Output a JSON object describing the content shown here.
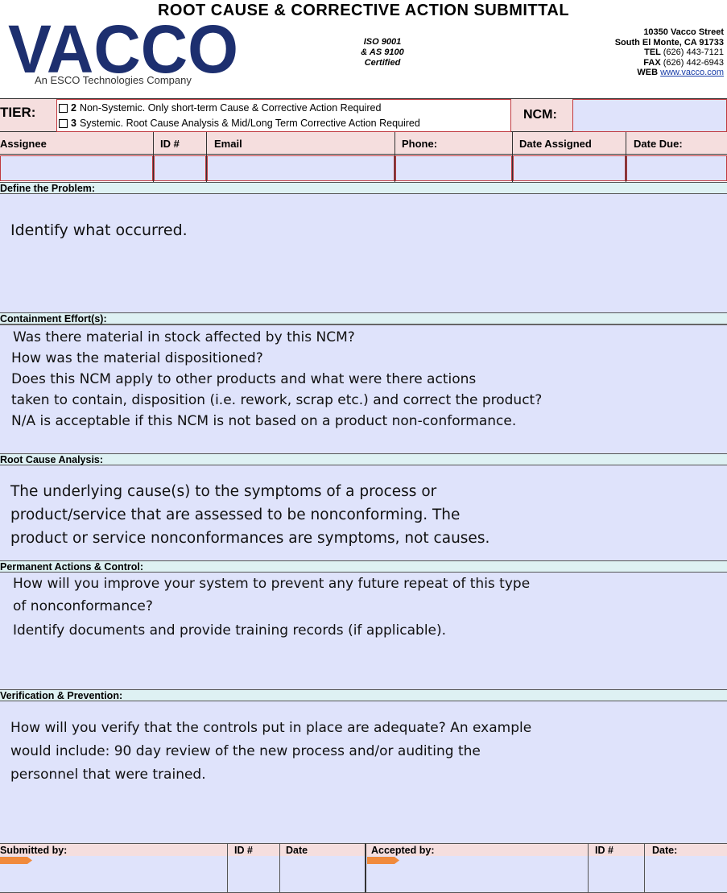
{
  "header": {
    "title": "ROOT CAUSE & CORRECTIVE ACTION SUBMITTAL",
    "logo_text": "VACCO",
    "tagline": "An ESCO Technologies Company",
    "certification": [
      "ISO 9001",
      "& AS 9100",
      "Certified"
    ],
    "address": {
      "street": "10350 Vacco Street",
      "city": "South El Monte, CA 91733",
      "tel_label": "TEL",
      "tel": "(626) 443-7121",
      "fax_label": "FAX",
      "fax": "(626) 442-6943",
      "web_label": "WEB",
      "web": "www.vacco.com"
    }
  },
  "tier": {
    "label": "TIER:",
    "option2_num": "2",
    "option2": "Non-Systemic.  Only short-term Cause & Corrective Action Required",
    "option3_num": "3",
    "option3": "Systemic.  Root Cause Analysis & Mid/Long Term Corrective Action Required",
    "ncm_label": "NCM:"
  },
  "assignment_headers": {
    "assignee": "Assignee",
    "id": "ID #",
    "email": "Email",
    "phone": "Phone:",
    "date_assigned": "Date Assigned",
    "date_due": "Date Due:"
  },
  "sections": {
    "problem": {
      "title": "Define the Problem:",
      "lines": [
        "Identify what occurred."
      ]
    },
    "containment": {
      "title": "Containment Effort(s):",
      "lines": [
        "Was there material in stock affected by this NCM?",
        "How was the material dispositioned?",
        "Does this NCM apply to other products and what were there actions",
        "taken to contain, disposition (i.e. rework, scrap etc.) and correct the product?",
        "N/A is acceptable if this NCM is not based on a product non-conformance."
      ]
    },
    "root_cause": {
      "title": "Root Cause Analysis:",
      "lines": [
        "The underlying cause(s) to the symptoms of a process or",
        "product/service that are assessed to be nonconforming.  The",
        "product or service nonconformances are symptoms, not causes."
      ]
    },
    "permanent": {
      "title": "Permanent Actions & Control:",
      "lines": [
        "How will you improve your system to prevent any future repeat of this type",
        "of nonconformance?",
        "Identify documents and provide training records (if applicable)."
      ]
    },
    "verification": {
      "title": "Verification & Prevention:",
      "lines": [
        "How will you verify that the controls put in place are adequate? An example",
        "would include: 90 day review of the new process and/or auditing the",
        "personnel that were trained."
      ]
    }
  },
  "footer": {
    "submitted_by": "Submitted by:",
    "submitted_id": "ID #",
    "submitted_date": "Date",
    "accepted_by": "Accepted by:",
    "accepted_id": "ID #",
    "accepted_date": "Date:"
  },
  "colors": {
    "accent_red": "#c0393f",
    "brand_navy": "#1d2f6f",
    "field_lavender": "#dfe3fb",
    "header_pink": "#f5dede",
    "section_cyan": "#def1f3",
    "sign_arrow": "#f08a3c"
  }
}
